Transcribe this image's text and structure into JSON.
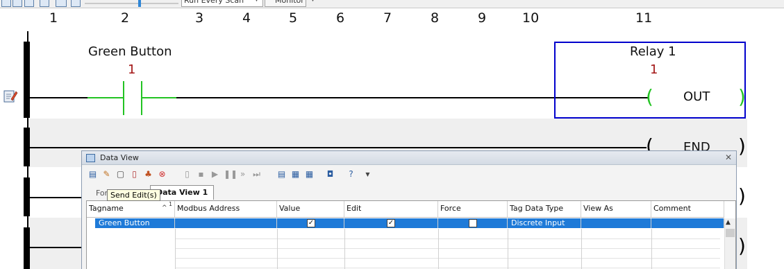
{
  "toolbar": {
    "scan_mode": "Run Every Scan",
    "mode_button": "Monitor",
    "slider_level": 0.57
  },
  "columns": [
    "1",
    "2",
    "3",
    "4",
    "5",
    "6",
    "7",
    "8",
    "9",
    "10",
    "11"
  ],
  "rung1": {
    "contact_tag": "Green Button",
    "contact_value": "1",
    "coil_tag": "Relay 1",
    "coil_value": "1",
    "coil_instruction": "OUT"
  },
  "rung2": {
    "instruction": "END"
  },
  "data_view": {
    "title": "Data View",
    "tooltip": "Send Edit(s)",
    "tabs": [
      "Force",
      "Data View 1"
    ],
    "sort_indicator": "1",
    "headers": [
      "Tagname",
      "Modbus Address",
      "Value",
      "Edit",
      "Force",
      "Tag Data Type",
      "View As",
      "Comment"
    ],
    "rows": [
      {
        "tagname": "Green Button",
        "modbus": "",
        "value": true,
        "edit": true,
        "force": false,
        "type": "Discrete Input",
        "view_as": "",
        "comment": ""
      }
    ],
    "colors": {
      "selection": "#1e7ad8"
    }
  },
  "colors": {
    "coil_box": "#0000cc",
    "energized": "#22c322",
    "value_text": "#a31515"
  }
}
